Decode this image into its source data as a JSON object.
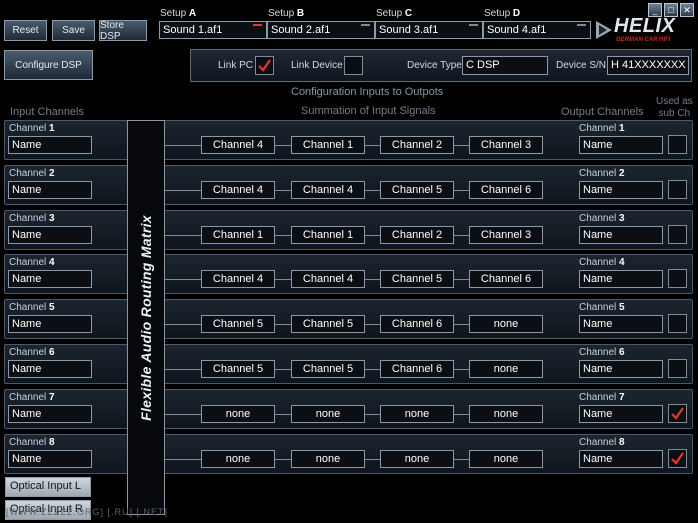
{
  "toolbar": {
    "reset": "Reset",
    "save": "Save",
    "store_dsp": "Store DSP",
    "configure_dsp": "Configure DSP"
  },
  "setups": [
    {
      "prefix": "Setup",
      "letter": "A",
      "value": "Sound 1.af1",
      "active": true
    },
    {
      "prefix": "Setup",
      "letter": "B",
      "value": "Sound 2.af1",
      "active": false
    },
    {
      "prefix": "Setup",
      "letter": "C",
      "value": "Sound 3.af1",
      "active": false
    },
    {
      "prefix": "Setup",
      "letter": "D",
      "value": "Sound 4.af1",
      "active": false
    }
  ],
  "window": {
    "minimize": "_",
    "maximize": "□",
    "close": "✕"
  },
  "logo": {
    "text": "HELIX",
    "tagline": "GERMAN CAR HIFI"
  },
  "link": {
    "link_pc_label": "Link PC",
    "link_pc_checked": true,
    "link_device_label": "Link Device",
    "link_device_checked": false,
    "device_type_label": "Device Type",
    "device_type_value": "C DSP",
    "device_sn_label": "Device S/N",
    "device_sn_value": "H 41XXXXXXX"
  },
  "headers": {
    "config_title": "Configuration Inputs to Outpots",
    "input_channels": "Input Channels",
    "summation": "Summation of Input Signals",
    "output_channels": "Output Channels",
    "used_as_line1": "Used as",
    "used_as_line2": "sub Ch"
  },
  "matrix_label": "Flexible Audio Routing Matrix",
  "channels": [
    {
      "input_prefix": "Channel",
      "input_num": "1",
      "input_name": "Name",
      "sums": [
        "Channel 4",
        "Channel 1",
        "Channel 2",
        "Channel 3"
      ],
      "output_prefix": "Channel",
      "output_num": "1",
      "output_name": "Name",
      "sub": false
    },
    {
      "input_prefix": "Channel",
      "input_num": "2",
      "input_name": "Name",
      "sums": [
        "Channel 4",
        "Channel 4",
        "Channel 5",
        "Channel 6"
      ],
      "output_prefix": "Channel",
      "output_num": "2",
      "output_name": "Name",
      "sub": false
    },
    {
      "input_prefix": "Channel",
      "input_num": "3",
      "input_name": "Name",
      "sums": [
        "Channel 1",
        "Channel 1",
        "Channel 2",
        "Channel 3"
      ],
      "output_prefix": "Channel",
      "output_num": "3",
      "output_name": "Name",
      "sub": false
    },
    {
      "input_prefix": "Channel",
      "input_num": "4",
      "input_name": "Name",
      "sums": [
        "Channel 4",
        "Channel 4",
        "Channel 5",
        "Channel 6"
      ],
      "output_prefix": "Channel",
      "output_num": "4",
      "output_name": "Name",
      "sub": false
    },
    {
      "input_prefix": "Channel",
      "input_num": "5",
      "input_name": "Name",
      "sums": [
        "Channel 5",
        "Channel 5",
        "Channel 6",
        "none"
      ],
      "output_prefix": "Channel",
      "output_num": "5",
      "output_name": "Name",
      "sub": false
    },
    {
      "input_prefix": "Channel",
      "input_num": "6",
      "input_name": "Name",
      "sums": [
        "Channel 5",
        "Channel 5",
        "Channel 6",
        "none"
      ],
      "output_prefix": "Channel",
      "output_num": "6",
      "output_name": "Name",
      "sub": false
    },
    {
      "input_prefix": "Channel",
      "input_num": "7",
      "input_name": "Name",
      "sums": [
        "none",
        "none",
        "none",
        "none"
      ],
      "output_prefix": "Channel",
      "output_num": "7",
      "output_name": "Name",
      "sub": true
    },
    {
      "input_prefix": "Channel",
      "input_num": "8",
      "input_name": "Name",
      "sums": [
        "none",
        "none",
        "none",
        "none"
      ],
      "output_prefix": "Channel",
      "output_num": "8",
      "output_name": "Name",
      "sub": true
    }
  ],
  "optical": [
    "Optical Input L",
    "Optical Input R"
  ],
  "watermark": "[WWW.ZZZZZ.ORG] [.RU] [.NET]",
  "colors": {
    "accent": "#e03a2a",
    "background": "#000000",
    "border": "#8c9aa8"
  }
}
